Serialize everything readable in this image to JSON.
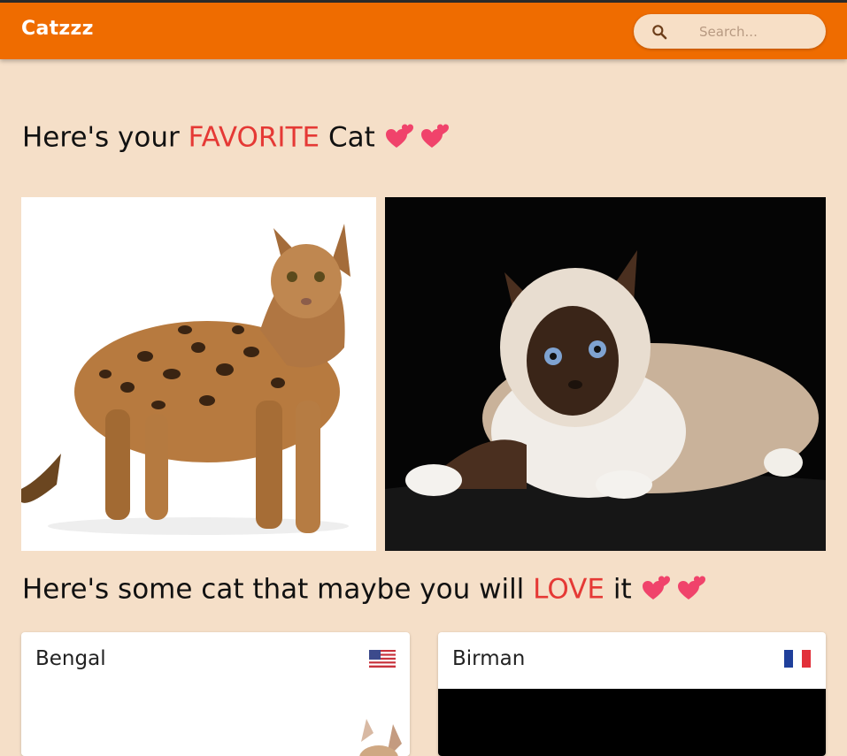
{
  "app": {
    "title": "Catzzz"
  },
  "search": {
    "placeholder": "Search..."
  },
  "favorite_section": {
    "prefix": "Here's your",
    "highlight": "FAVORITE",
    "suffix": "Cat",
    "hearts": [
      "two-hearts-icon",
      "two-hearts-icon"
    ]
  },
  "recommend_section": {
    "prefix": "Here's some cat that maybe you will",
    "highlight": "LOVE",
    "suffix": "it",
    "hearts": [
      "two-hearts-icon",
      "two-hearts-icon"
    ]
  },
  "favorites": [
    {
      "photo": "bengal-cat-photo"
    },
    {
      "photo": "birman-cat-photo"
    }
  ],
  "cards": [
    {
      "name": "Bengal",
      "flag": "us-flag-icon"
    },
    {
      "name": "Birman",
      "flag": "fr-flag-icon"
    }
  ],
  "colors": {
    "appbar": "#ef6c00",
    "background": "#f5dfc8",
    "accent": "#e53935",
    "heart": "#f0436b"
  }
}
